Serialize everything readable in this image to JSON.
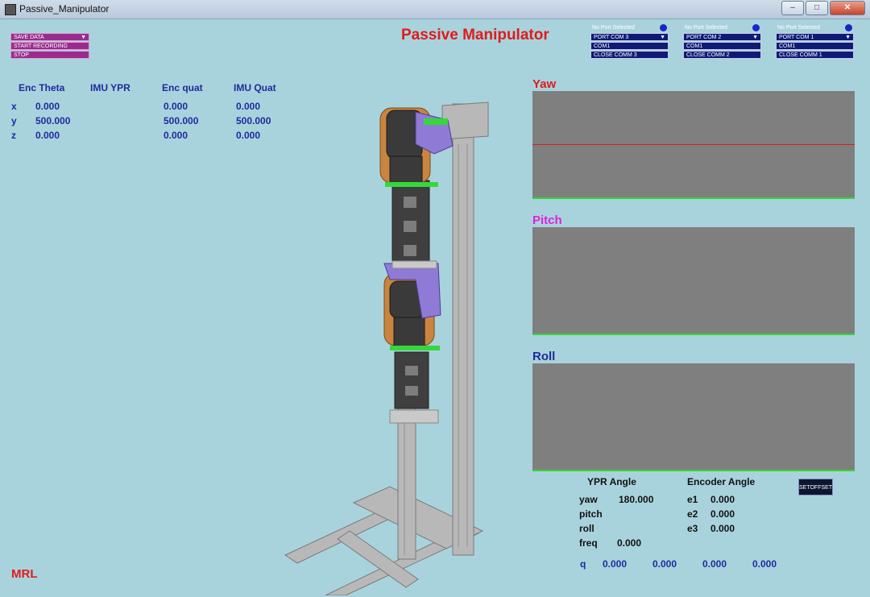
{
  "window": {
    "title": "Passive_Manipulator",
    "minimize": "‒",
    "maximize": "□",
    "close": "✕"
  },
  "app_title": "Passive Manipulator",
  "menu": {
    "save_data": "SAVE DATA",
    "start_recording": "START RECORDING",
    "stop": "STOP"
  },
  "ports": [
    {
      "status": "No Port Selected",
      "selected": "PORT COM 3",
      "com": "COM1",
      "close_label": "CLOSE COMM 3",
      "indicator_color": "#1a25c9"
    },
    {
      "status": "No Port Selected",
      "selected": "PORT COM 2",
      "com": "COM1",
      "close_label": "CLOSE COMM 2",
      "indicator_color": "#1a25c9"
    },
    {
      "status": "No Port Selected",
      "selected": "PORT COM 1",
      "com": "COM1",
      "close_label": "CLOSE COMM 1",
      "indicator_color": "#1a25c9"
    }
  ],
  "table": {
    "headers": [
      "Enc Theta",
      "IMU YPR",
      "Enc quat",
      "IMU Quat"
    ],
    "rows": [
      {
        "axis": "x",
        "enc_theta": "0.000",
        "enc_quat": "0.000",
        "imu_quat": "0.000"
      },
      {
        "axis": "y",
        "enc_theta": "500.000",
        "enc_quat": "500.000",
        "imu_quat": "500.000"
      },
      {
        "axis": "z",
        "enc_theta": "0.000",
        "enc_quat": "0.000",
        "imu_quat": "0.000"
      }
    ]
  },
  "plots": {
    "yaw": {
      "label": "Yaw",
      "color": "#e11b1b",
      "trace_color": "#d62020"
    },
    "pitch": {
      "label": "Pitch",
      "color": "#e020e0"
    },
    "roll": {
      "label": "Roll",
      "color": "#1e2aa0"
    }
  },
  "readouts": {
    "ypr_header": "YPR Angle",
    "encoder_header": "Encoder Angle",
    "yaw_label": "yaw",
    "yaw_value": "180.000",
    "pitch_label": "pitch",
    "roll_label": "roll",
    "freq_label": "freq",
    "freq_value": "0.000",
    "e1_label": "e1",
    "e1_value": "0.000",
    "e2_label": "e2",
    "e2_value": "0.000",
    "e3_label": "e3",
    "e3_value": "0.000",
    "setoffset": "SETOFFSET"
  },
  "quaternion": {
    "label": "q",
    "values": [
      "0.000",
      "0.000",
      "0.000",
      "0.000"
    ]
  },
  "logo": "MRL",
  "colors": {
    "background": "#a9d3dc",
    "plot_bg": "#7f7f7f",
    "plot_axis": "#35d435",
    "label_blue": "#1e2aa0"
  }
}
